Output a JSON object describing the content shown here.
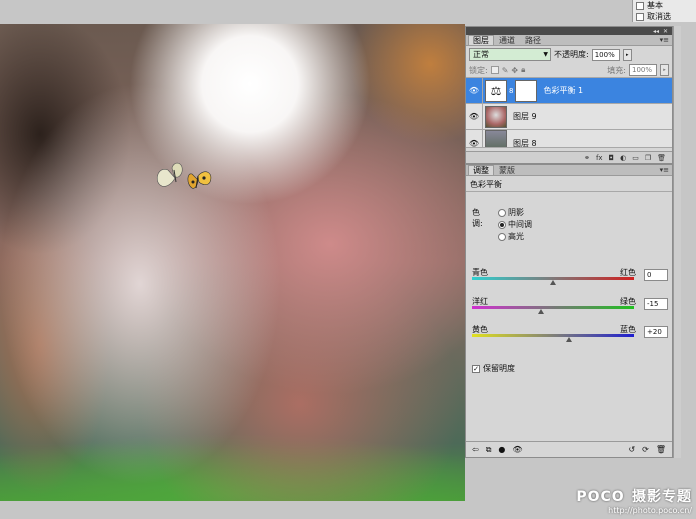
{
  "top_fragment": {
    "item1": "基本",
    "item2": "取消选"
  },
  "layers_panel": {
    "tabs": [
      "图层",
      "通道",
      "路径"
    ],
    "blend_mode": "正常",
    "opacity_label": "不透明度:",
    "opacity_value": "100%",
    "lock_label": "锁定:",
    "fill_label": "填充:",
    "fill_value": "100%",
    "layers": [
      {
        "name": "色彩平衡 1",
        "selected": true
      },
      {
        "name": "图层 9",
        "selected": false
      },
      {
        "name": "图层 8",
        "selected": false
      }
    ],
    "bottom_icons": [
      "link-icon",
      "fx-icon",
      "mask-icon",
      "adjustment-icon",
      "group-icon",
      "new-layer-icon",
      "trash-icon"
    ]
  },
  "adjust_panel": {
    "tabs": [
      "调整",
      "蒙版"
    ],
    "title": "色彩平衡",
    "tone_label": "色调:",
    "tone_options": [
      {
        "label": "阴影",
        "checked": false
      },
      {
        "label": "中间调",
        "checked": true
      },
      {
        "label": "高光",
        "checked": false
      }
    ],
    "sliders": [
      {
        "left": "青色",
        "right": "红色",
        "value": "0",
        "gradient": "linear-gradient(90deg,#2fd0d0,#d02020)",
        "level": 0
      },
      {
        "left": "洋红",
        "right": "绿色",
        "value": "-15",
        "gradient": "linear-gradient(90deg,#d030d0,#20c020)",
        "level": -15
      },
      {
        "left": "黄色",
        "right": "蓝色",
        "value": "+20",
        "gradient": "linear-gradient(90deg,#e0e020,#2020d0)",
        "level": 20
      }
    ],
    "preserve_label": "保留明度",
    "preserve_checked": true
  },
  "watermark": {
    "brand": "POCO",
    "sub": "摄影专题",
    "url": "http://photo.poco.cn/"
  }
}
